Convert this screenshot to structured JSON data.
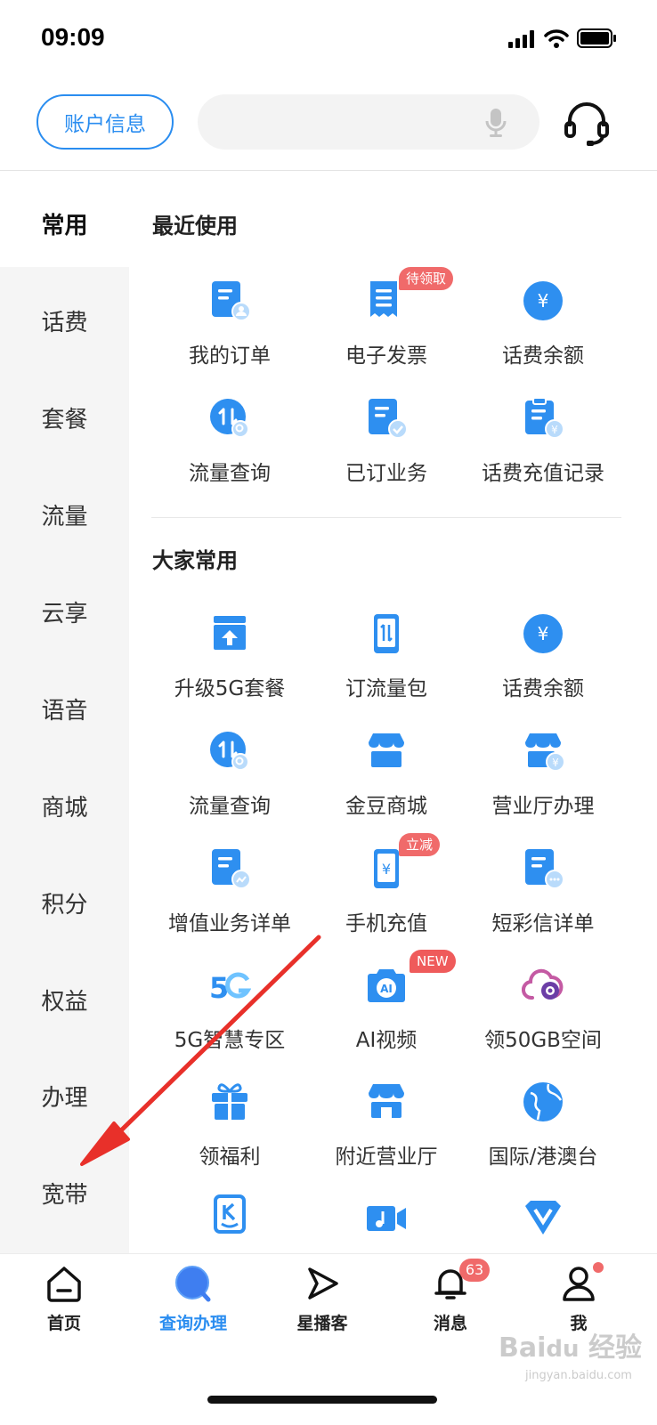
{
  "status_bar": {
    "time": "09:09"
  },
  "header": {
    "account_button": "账户信息"
  },
  "sidebar": {
    "items": [
      {
        "label": "常用",
        "active": true
      },
      {
        "label": "话费"
      },
      {
        "label": "套餐"
      },
      {
        "label": "流量"
      },
      {
        "label": "云享"
      },
      {
        "label": "语音"
      },
      {
        "label": "商城"
      },
      {
        "label": "积分"
      },
      {
        "label": "权益"
      },
      {
        "label": "办理"
      },
      {
        "label": "宽带"
      }
    ]
  },
  "recent": {
    "title": "最近使用",
    "items": [
      {
        "label": "我的订单",
        "icon": "order-icon"
      },
      {
        "label": "电子发票",
        "icon": "invoice-icon",
        "badge": "待领取"
      },
      {
        "label": "话费余额",
        "icon": "yuan-circle-icon"
      },
      {
        "label": "流量查询",
        "icon": "data-query-icon"
      },
      {
        "label": "已订业务",
        "icon": "subscribed-icon"
      },
      {
        "label": "话费充值记录",
        "icon": "recharge-record-icon"
      }
    ]
  },
  "popular": {
    "title": "大家常用",
    "items": [
      {
        "label": "升级5G套餐",
        "icon": "upgrade-icon"
      },
      {
        "label": "订流量包",
        "icon": "phone-data-icon"
      },
      {
        "label": "话费余额",
        "icon": "yuan-circle-icon"
      },
      {
        "label": "流量查询",
        "icon": "data-query-icon"
      },
      {
        "label": "金豆商城",
        "icon": "shop-icon"
      },
      {
        "label": "营业厅办理",
        "icon": "store-yuan-icon"
      },
      {
        "label": "增值业务详单",
        "icon": "detail-chart-icon"
      },
      {
        "label": "手机充值",
        "icon": "phone-yuan-icon",
        "badge": "立减"
      },
      {
        "label": "短彩信详单",
        "icon": "message-detail-icon"
      },
      {
        "label": "5G智慧专区",
        "icon": "5g-logo-icon"
      },
      {
        "label": "AI视频",
        "icon": "ai-camera-icon",
        "badge": "NEW"
      },
      {
        "label": "领50GB空间",
        "icon": "cloud-icon"
      },
      {
        "label": "领福利",
        "icon": "gift-icon"
      },
      {
        "label": "附近营业厅",
        "icon": "nearby-store-icon"
      },
      {
        "label": "国际/港澳台",
        "icon": "globe-icon"
      },
      {
        "label": "",
        "icon": "k-card-icon"
      },
      {
        "label": "",
        "icon": "music-video-icon"
      },
      {
        "label": "",
        "icon": "v-diamond-icon"
      }
    ]
  },
  "bottom_nav": {
    "items": [
      {
        "label": "首页",
        "icon": "home-icon"
      },
      {
        "label": "查询办理",
        "icon": "query-icon",
        "active": true
      },
      {
        "label": "星播客",
        "icon": "play-arrow-icon"
      },
      {
        "label": "消息",
        "icon": "bell-icon",
        "badge": "63"
      },
      {
        "label": "我",
        "icon": "person-icon"
      }
    ]
  },
  "colors": {
    "accent": "#2a8df0",
    "icon_blue": "#2e8ff0",
    "badge_red": "#f06a6a",
    "arrow_red": "#e8302a"
  },
  "watermark": "Baidu经验 jingyan.baidu.com"
}
